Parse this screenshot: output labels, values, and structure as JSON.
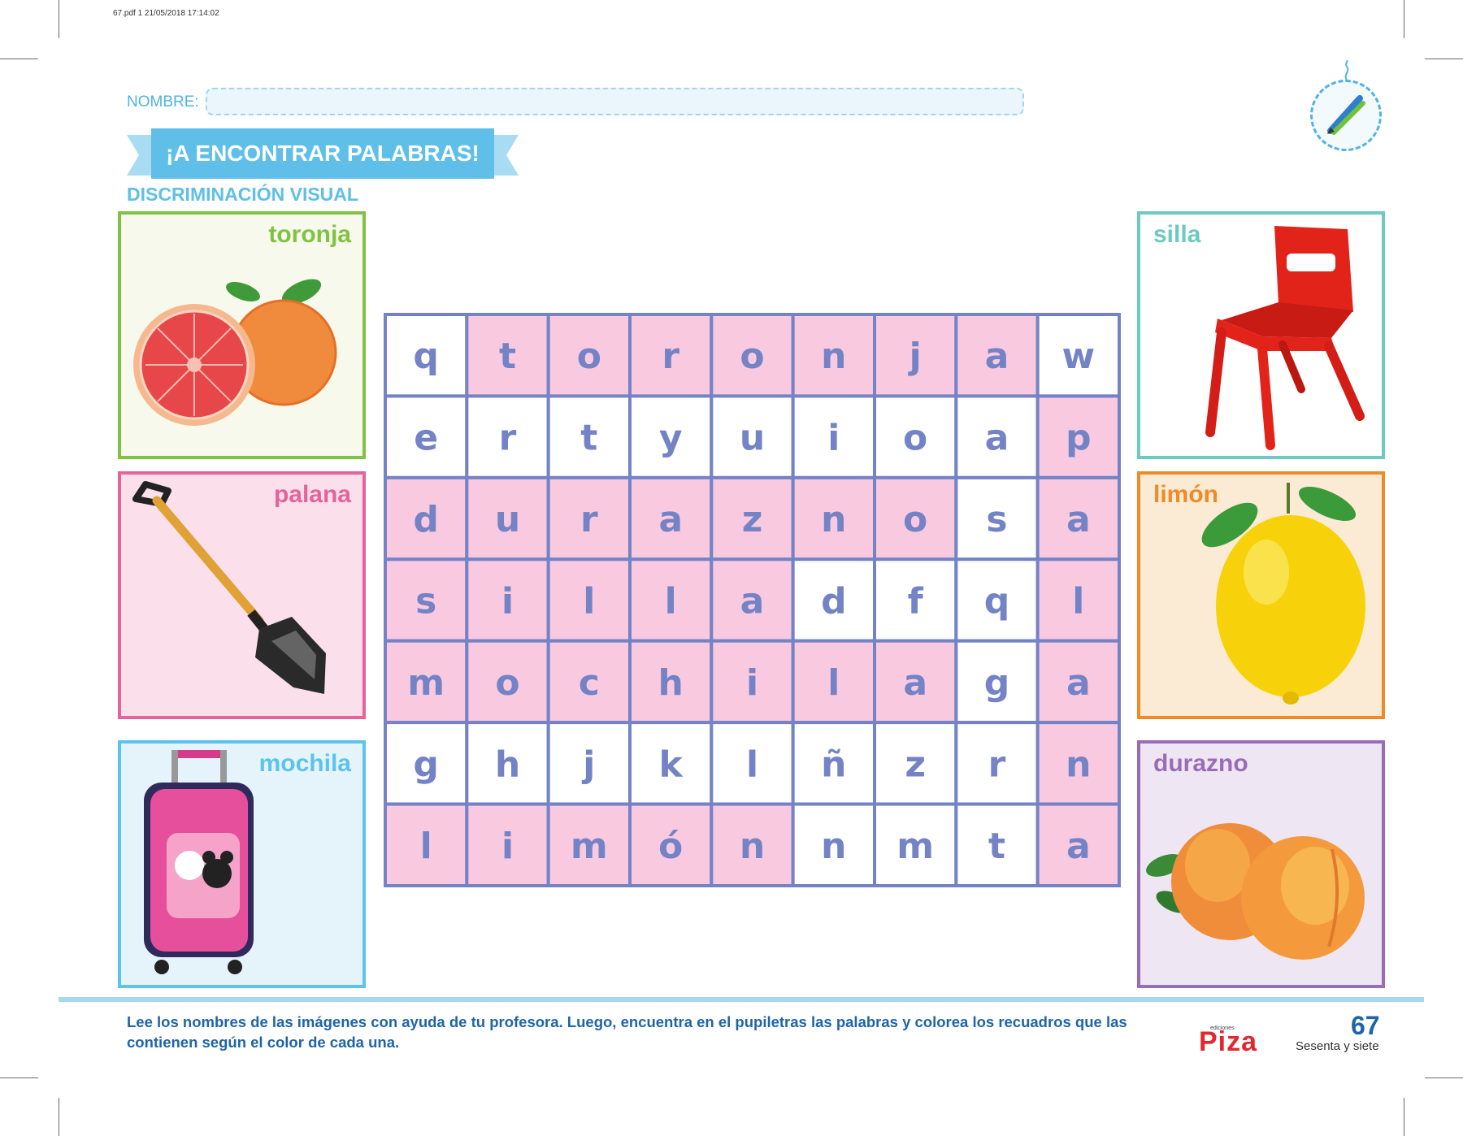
{
  "print_meta": "67.pdf   1   21/05/2018   17:14:02",
  "header": {
    "name_label": "NOMBRE:",
    "title": "¡A ENCONTRAR PALABRAS!",
    "subtitle": "DISCRIMINACIÓN VISUAL"
  },
  "cards": [
    {
      "label": "toronja",
      "color": "#80c342",
      "bg": "#f6f9ec",
      "image": "grapefruit-illustration"
    },
    {
      "label": "palana",
      "color": "#e6629c",
      "bg": "#fbe0eb",
      "image": "shovel-illustration"
    },
    {
      "label": "mochila",
      "color": "#5cc3ec",
      "bg": "#e5f4fb",
      "image": "backpack-illustration"
    },
    {
      "label": "silla",
      "color": "#6ccac1",
      "bg": "#ffffff",
      "image": "chair-illustration"
    },
    {
      "label": "limón",
      "color": "#ee8a27",
      "bg": "#fcebd4",
      "image": "lemon-illustration"
    },
    {
      "label": "durazno",
      "color": "#9b6cb6",
      "bg": "#eee6f3",
      "image": "peach-illustration"
    }
  ],
  "word_search": {
    "rows": [
      [
        "q",
        "t",
        "o",
        "r",
        "o",
        "n",
        "j",
        "a",
        "w"
      ],
      [
        "e",
        "r",
        "t",
        "y",
        "u",
        "i",
        "o",
        "a",
        "p"
      ],
      [
        "d",
        "u",
        "r",
        "a",
        "z",
        "n",
        "o",
        "s",
        "a"
      ],
      [
        "s",
        "i",
        "l",
        "l",
        "a",
        "d",
        "f",
        "q",
        "l"
      ],
      [
        "m",
        "o",
        "c",
        "h",
        "i",
        "l",
        "a",
        "g",
        "a"
      ],
      [
        "g",
        "h",
        "j",
        "k",
        "l",
        "ñ",
        "z",
        "r",
        "n"
      ],
      [
        "l",
        "i",
        "m",
        "ó",
        "n",
        "n",
        "m",
        "t",
        "a"
      ]
    ],
    "shaded": [
      [
        0,
        1,
        1,
        1,
        1,
        1,
        1,
        1,
        0
      ],
      [
        0,
        0,
        0,
        0,
        0,
        0,
        0,
        0,
        1
      ],
      [
        1,
        1,
        1,
        1,
        1,
        1,
        1,
        0,
        1
      ],
      [
        1,
        1,
        1,
        1,
        1,
        0,
        0,
        0,
        1
      ],
      [
        1,
        1,
        1,
        1,
        1,
        1,
        1,
        0,
        1
      ],
      [
        0,
        0,
        0,
        0,
        0,
        0,
        0,
        0,
        1
      ],
      [
        1,
        1,
        1,
        1,
        1,
        0,
        0,
        0,
        1
      ]
    ],
    "shade_color": "#f9c9e0",
    "border_color": "#7483c6",
    "letter_color": "#7483c6"
  },
  "footer": {
    "instructions": "Lee los nombres de las imágenes con ayuda de tu profesora. Luego, encuentra en el pupiletras las palabras y colorea los recuadros que las contienen según el color de cada una.",
    "brand_small": "ediciones",
    "brand": "Piza",
    "page_number": "67",
    "page_words": "Sesenta y siete"
  }
}
